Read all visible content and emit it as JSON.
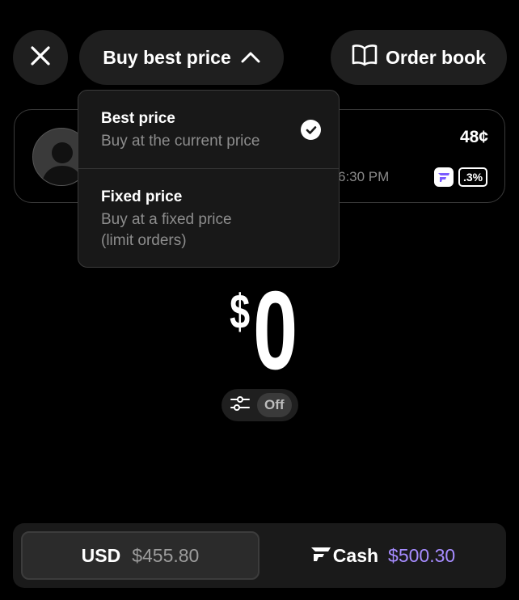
{
  "header": {
    "close_icon": "close-icon",
    "mode_label": "Buy best price",
    "mode_icon": "chevron-up-icon",
    "order_book_label": "Order book",
    "order_book_icon": "book-open-icon"
  },
  "dropdown": {
    "options": [
      {
        "title": "Best price",
        "subtitle": "Buy at the current price",
        "selected": true
      },
      {
        "title": "Fixed price",
        "subtitle_line1": "Buy at a fixed price",
        "subtitle_line2": "(limit orders)",
        "selected": false
      }
    ],
    "check_icon": "check-circle-icon"
  },
  "market": {
    "price": "48¢",
    "time": "6:30 PM",
    "badge": ".3%",
    "brand_icon": "brand-logo-icon"
  },
  "amount": {
    "currency": "$",
    "value": "0"
  },
  "settings": {
    "icon": "sliders-icon",
    "state": "Off"
  },
  "balances": {
    "usd": {
      "label": "USD",
      "amount": "$455.80"
    },
    "cash": {
      "label": "Cash",
      "amount": "$500.30",
      "accent": "#a68cff"
    }
  },
  "colors": {
    "background": "#000000",
    "surface": "#1f1f1f",
    "accent": "#a68cff",
    "brand_badge": "#7b5cff"
  }
}
